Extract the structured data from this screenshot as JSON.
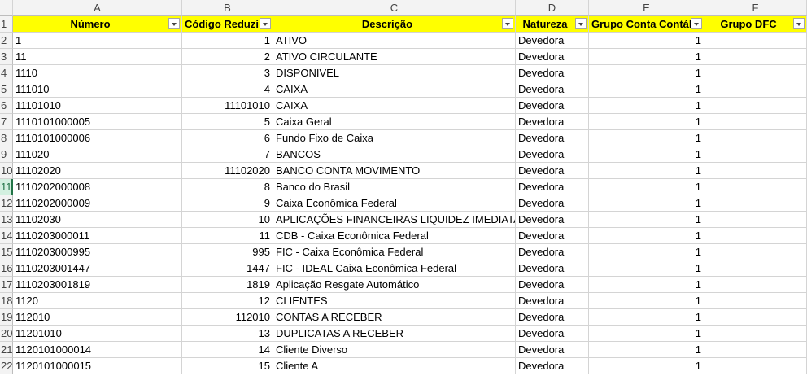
{
  "columns": [
    "A",
    "B",
    "C",
    "D",
    "E",
    "F"
  ],
  "header": {
    "row_num": "1",
    "numero": "Número",
    "codigo": "Código Reduzi",
    "descricao": "Descrição",
    "natureza": "Natureza",
    "grupo_conta": "Grupo Conta Contál",
    "grupo_dfc": "Grupo DFC"
  },
  "rows": [
    {
      "n": "2",
      "numero": "1",
      "codigo": "1",
      "descricao": "ATIVO",
      "natureza": "Devedora",
      "grupo": "1"
    },
    {
      "n": "3",
      "numero": "11",
      "codigo": "2",
      "descricao": "ATIVO CIRCULANTE",
      "natureza": "Devedora",
      "grupo": "1"
    },
    {
      "n": "4",
      "numero": "1110",
      "codigo": "3",
      "descricao": "DISPONIVEL",
      "natureza": "Devedora",
      "grupo": "1"
    },
    {
      "n": "5",
      "numero": "111010",
      "codigo": "4",
      "descricao": "CAIXA",
      "natureza": "Devedora",
      "grupo": "1"
    },
    {
      "n": "6",
      "numero": "11101010",
      "codigo": "11101010",
      "descricao": "CAIXA",
      "natureza": "Devedora",
      "grupo": "1"
    },
    {
      "n": "7",
      "numero": "1110101000005",
      "codigo": "5",
      "descricao": "Caixa Geral",
      "natureza": "Devedora",
      "grupo": "1"
    },
    {
      "n": "8",
      "numero": "1110101000006",
      "codigo": "6",
      "descricao": "Fundo Fixo de Caixa",
      "natureza": "Devedora",
      "grupo": "1"
    },
    {
      "n": "9",
      "numero": "111020",
      "codigo": "7",
      "descricao": "BANCOS",
      "natureza": "Devedora",
      "grupo": "1"
    },
    {
      "n": "10",
      "numero": "11102020",
      "codigo": "11102020",
      "descricao": "BANCO CONTA MOVIMENTO",
      "natureza": "Devedora",
      "grupo": "1"
    },
    {
      "n": "11",
      "numero": "1110202000008",
      "codigo": "8",
      "descricao": "Banco do Brasil",
      "natureza": "Devedora",
      "grupo": "1"
    },
    {
      "n": "12",
      "numero": "1110202000009",
      "codigo": "9",
      "descricao": "Caixa Econômica Federal",
      "natureza": "Devedora",
      "grupo": "1"
    },
    {
      "n": "13",
      "numero": "11102030",
      "codigo": "10",
      "descricao": "APLICAÇÕES FINANCEIRAS LIQUIDEZ IMEDIATA",
      "natureza": "Devedora",
      "grupo": "1"
    },
    {
      "n": "14",
      "numero": "1110203000011",
      "codigo": "11",
      "descricao": "CDB - Caixa Econômica Federal",
      "natureza": "Devedora",
      "grupo": "1"
    },
    {
      "n": "15",
      "numero": "1110203000995",
      "codigo": "995",
      "descricao": "FIC - Caixa Econômica Federal",
      "natureza": "Devedora",
      "grupo": "1"
    },
    {
      "n": "16",
      "numero": "1110203001447",
      "codigo": "1447",
      "descricao": "FIC - IDEAL Caixa Econômica Federal",
      "natureza": "Devedora",
      "grupo": "1"
    },
    {
      "n": "17",
      "numero": "1110203001819",
      "codigo": "1819",
      "descricao": "Aplicação Resgate Automático",
      "natureza": "Devedora",
      "grupo": "1"
    },
    {
      "n": "18",
      "numero": "1120",
      "codigo": "12",
      "descricao": "CLIENTES",
      "natureza": "Devedora",
      "grupo": "1"
    },
    {
      "n": "19",
      "numero": "112010",
      "codigo": "112010",
      "descricao": "CONTAS A RECEBER",
      "natureza": "Devedora",
      "grupo": "1"
    },
    {
      "n": "20",
      "numero": "11201010",
      "codigo": "13",
      "descricao": "DUPLICATAS A RECEBER",
      "natureza": "Devedora",
      "grupo": "1"
    },
    {
      "n": "21",
      "numero": "1120101000014",
      "codigo": "14",
      "descricao": "Cliente Diverso",
      "natureza": "Devedora",
      "grupo": "1"
    },
    {
      "n": "22",
      "numero": "1120101000015",
      "codigo": "15",
      "descricao": "Cliente A",
      "natureza": "Devedora",
      "grupo": "1"
    }
  ],
  "selected_row": "11",
  "colors": {
    "header_fill": "#ffff00",
    "selected_row_header": "#d3f0e0",
    "excel_green": "#217346"
  }
}
